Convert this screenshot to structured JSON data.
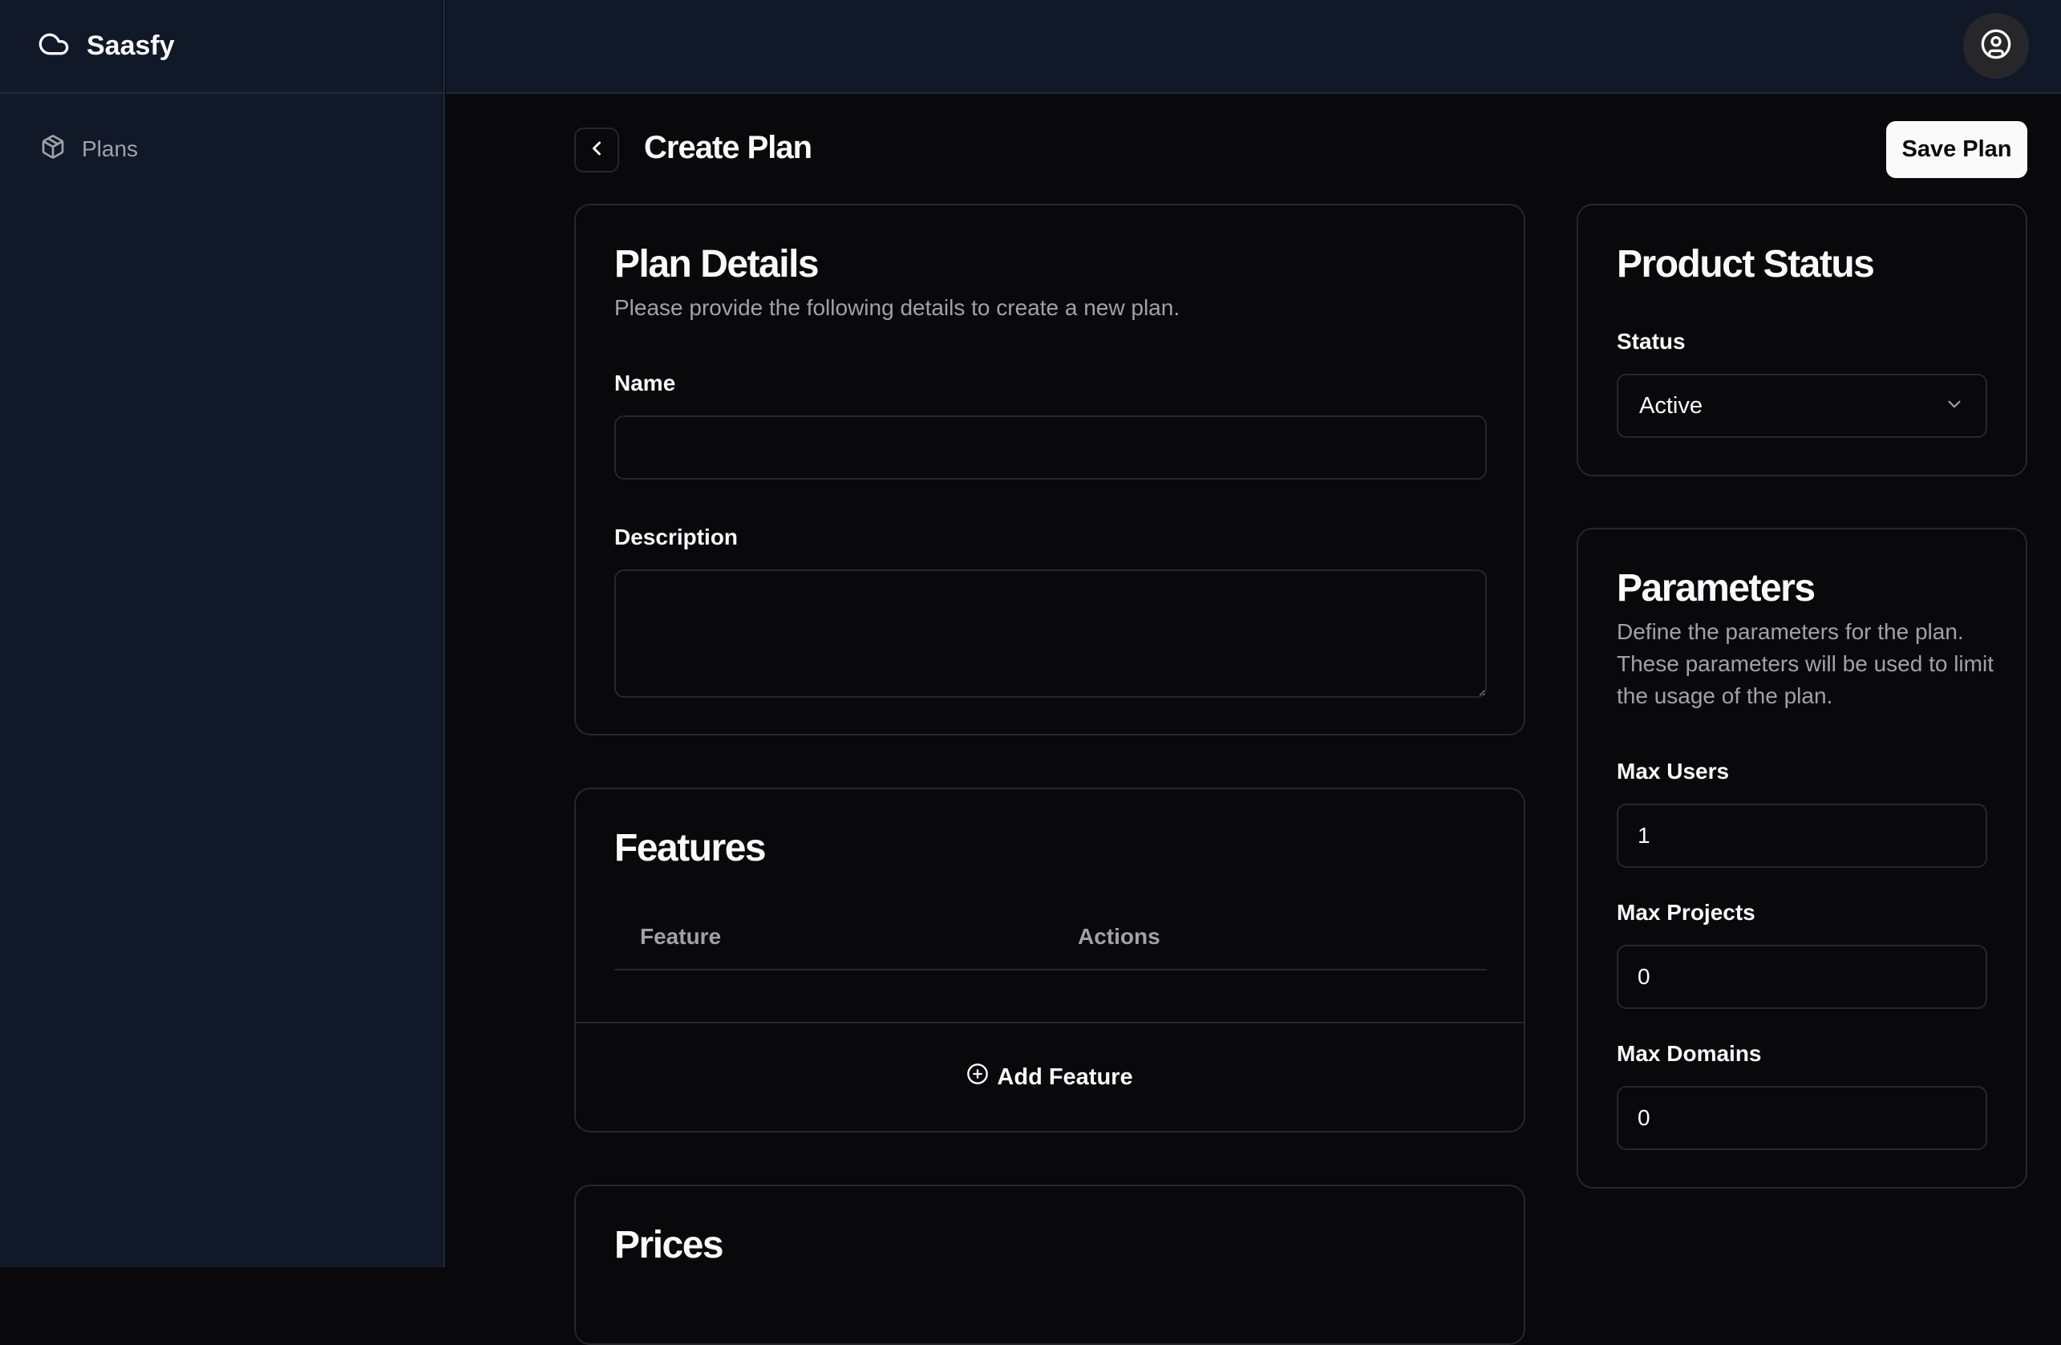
{
  "app": {
    "name": "Saasfy",
    "logo_icon": "cloud-icon"
  },
  "sidebar": {
    "items": [
      {
        "label": "Plans",
        "icon": "package-icon"
      }
    ]
  },
  "header": {
    "user_icon": "user-circle-icon"
  },
  "page": {
    "title": "Create Plan",
    "back_icon": "chevron-left-icon",
    "save_label": "Save Plan"
  },
  "plan_details": {
    "title": "Plan Details",
    "description": "Please provide the following details to create a new plan.",
    "name_label": "Name",
    "name_value": "",
    "description_label": "Description",
    "description_value": ""
  },
  "features": {
    "title": "Features",
    "columns": [
      "Feature",
      "Actions"
    ],
    "rows": [],
    "add_label": "Add Feature",
    "add_icon": "plus-circle-icon"
  },
  "prices": {
    "title": "Prices"
  },
  "product_status": {
    "title": "Product Status",
    "status_label": "Status",
    "status_value": "Active",
    "dropdown_icon": "chevron-down-icon"
  },
  "parameters": {
    "title": "Parameters",
    "description": "Define the parameters for the plan. These parameters will be used to limit the usage of the plan.",
    "fields": [
      {
        "label": "Max Users",
        "value": "1"
      },
      {
        "label": "Max Projects",
        "value": "0"
      },
      {
        "label": "Max Domains",
        "value": "0"
      }
    ]
  },
  "colors": {
    "background": "#09090b",
    "sidebar": "#111827",
    "border": "#27272a",
    "muted_text": "#a1a1aa",
    "primary_button": "#fafafa"
  }
}
